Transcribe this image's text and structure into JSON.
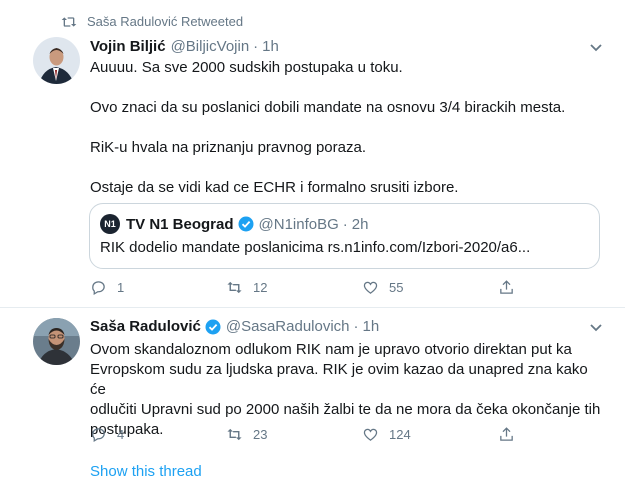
{
  "retweet_context": {
    "text": "Saša Radulović Retweeted",
    "icon": "retweet-icon"
  },
  "tweet1": {
    "name": "Vojin Biljić",
    "handle": "@BiljicVojin",
    "separator": "·",
    "time": "1h",
    "paragraphs": [
      "Auuuu. Sa sve 2000 sudskih postupaka u toku.",
      "Ovo znaci da su poslanici dobili mandate na osnovu 3/4 birackih mesta.",
      "RiK-u hvala na priznanju pravnog poraza.",
      "Ostaje da se vidi kad ce ECHR i formalno srusiti izbore."
    ],
    "quote": {
      "logo_text": "N1",
      "name": "TV N1 Beograd",
      "handle": "@N1infoBG",
      "separator": "·",
      "time": "2h",
      "text": "RIK dodelio mandate poslanicima rs.n1info.com/Izbori-2020/a6..."
    },
    "actions": {
      "reply": "1",
      "retweet": "12",
      "like": "55"
    }
  },
  "tweet2": {
    "name": "Saša Radulović",
    "handle": "@SasaRadulovich",
    "separator": "·",
    "time": "1h",
    "lines": [
      "Ovom skandaloznom odlukom RIK nam je upravo otvorio direktan put ka",
      "Evropskom sudu za ljudska prava. RIK je ovim kazao da unapred zna kako će",
      "odlučiti Upravni sud po 2000 naših žalbi te da ne mora da čeka okončanje tih",
      "postupaka."
    ],
    "actions": {
      "reply": "4",
      "retweet": "23",
      "like": "124"
    }
  },
  "show_thread": "Show this thread",
  "colors": {
    "accent": "#1da1f2",
    "secondary_text": "#657786",
    "border": "#e6ecf0",
    "verified": "#1da1f2"
  }
}
